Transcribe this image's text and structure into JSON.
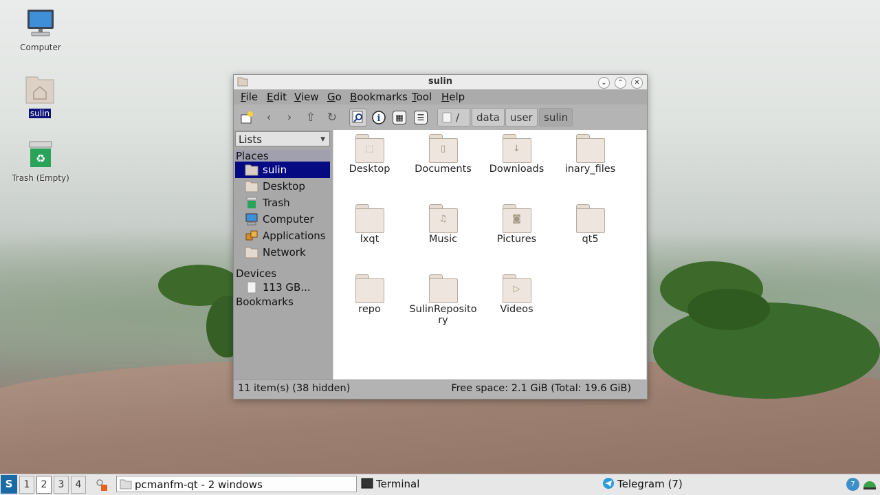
{
  "desktop": {
    "icons": [
      {
        "label": "Computer",
        "icon": "computer-icon"
      },
      {
        "label": "sulin",
        "icon": "home-folder-icon"
      },
      {
        "label": "Trash (Empty)",
        "icon": "trash-icon"
      }
    ]
  },
  "window": {
    "title": "sulin",
    "menu": [
      "File",
      "Edit",
      "View",
      "Go",
      "Bookmarks",
      "Tool",
      "Help"
    ],
    "path": {
      "root": "/",
      "segments": [
        "data",
        "user",
        "sulin"
      ]
    },
    "side": {
      "mode": "Lists",
      "places_header": "Places",
      "places": [
        "sulin",
        "Desktop",
        "Trash",
        "Computer",
        "Applications",
        "Network"
      ],
      "devices_header": "Devices",
      "devices": [
        "113 GB..."
      ],
      "bookmarks_header": "Bookmarks"
    },
    "files": [
      {
        "name": "Desktop",
        "emblem": "desktop"
      },
      {
        "name": "Documents",
        "emblem": "document"
      },
      {
        "name": "Downloads",
        "emblem": "download"
      },
      {
        "name": "inary_files",
        "emblem": ""
      },
      {
        "name": "lxqt",
        "emblem": ""
      },
      {
        "name": "Music",
        "emblem": "music"
      },
      {
        "name": "Pictures",
        "emblem": "camera"
      },
      {
        "name": "qt5",
        "emblem": ""
      },
      {
        "name": "repo",
        "emblem": ""
      },
      {
        "name": "SulinRepository",
        "emblem": ""
      },
      {
        "name": "Videos",
        "emblem": "video"
      }
    ],
    "status_left": "11 item(s) (38 hidden)",
    "status_right": "Free space: 2.1 GiB (Total: 19.6 GiB)"
  },
  "taskbar": {
    "desktops": [
      "1",
      "2",
      "3",
      "4"
    ],
    "current_desktop": "2",
    "tasks": [
      "pcmanfm-qt - 2 windows",
      "Terminal",
      "Telegram (7)"
    ],
    "tray_badge": "7"
  }
}
